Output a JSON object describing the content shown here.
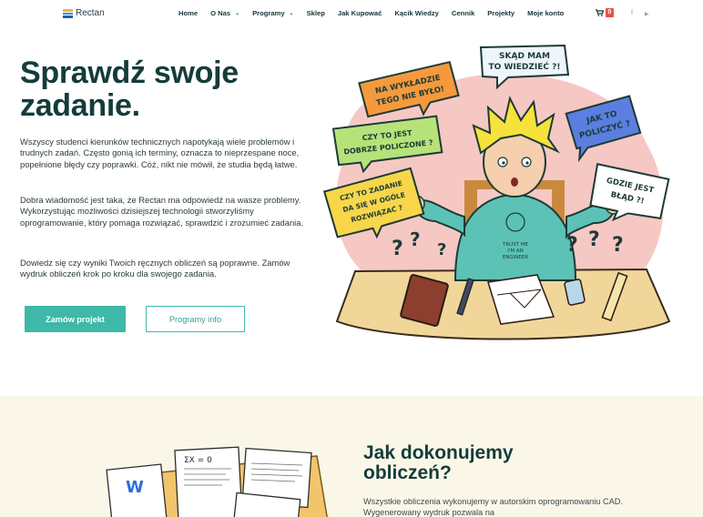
{
  "header": {
    "logo_text": "Rectan",
    "nav": [
      {
        "label": "Home",
        "has_dropdown": false
      },
      {
        "label": "O Nas",
        "has_dropdown": true
      },
      {
        "label": "Programy",
        "has_dropdown": true
      },
      {
        "label": "Sklep",
        "has_dropdown": false
      },
      {
        "label": "Jak Kupować",
        "has_dropdown": false
      },
      {
        "label": "Kącik Wiedzy",
        "has_dropdown": false
      },
      {
        "label": "Cennik",
        "has_dropdown": false
      },
      {
        "label": "Projekty",
        "has_dropdown": false
      },
      {
        "label": "Moje konto",
        "has_dropdown": false
      }
    ],
    "cart_count": "0",
    "social": {
      "facebook": "f",
      "youtube": "▶"
    }
  },
  "hero": {
    "title": "Sprawdź swoje zadanie.",
    "paragraph1": "Wszyscy studenci kierunków technicznych napotykają wiele problemów i trudnych zadań. Często gonią ich terminy, oznacza to nieprzespane noce, popełnione błędy czy poprawki. Cóż, nikt nie mówił, że studia będą łatwe.",
    "paragraph2": "Dobra wiadomość jest taka, że Rectan ma odpowiedź na wasze problemy. Wykorzystując możliwości dzisiejszej technologii stworzyliśmy oprogramowanie, który pomaga rozwiązać, sprawdzić i zrozumieć zadania.",
    "paragraph3": "Dowiedz się czy wyniki Twoich ręcznych obliczeń są poprawne. Zamów wydruk obliczeń krok po kroku dla swojego zadania.",
    "primary_button": "Zamów projekt",
    "secondary_button": "Programy info",
    "bubbles": {
      "b1": "SKĄD MAM\nTO WIEDZIEĆ ?!",
      "b2": "NA WYKŁADZIE\nTEGO NIE BYŁO!",
      "b3": "CZY TO JEST\nDOBRZE POLICZONE ?",
      "b4": "JAK TO\nPOLICZYĆ ?",
      "b5": "CZY TO ZADANIE\nDA SIĘ W OGÓLE\nROZWIĄZAĆ ?",
      "b6": "GDZIE JEST\nBŁĄD ?!"
    },
    "shirt_text": "TRUST ME\nI'M AN\nENGINEER"
  },
  "section2": {
    "title": "Jak dokonujemy obliczeń?",
    "paragraph": "Wszystkie obliczenia wykonujemy w autorskim oprogramowaniu CAD. Wygenerowany wydruk pozwala na"
  },
  "colors": {
    "accent": "#3eb8a8",
    "heading": "#143c3b",
    "cart_badge": "#e8533f",
    "section_bg": "#fbf7e8"
  }
}
